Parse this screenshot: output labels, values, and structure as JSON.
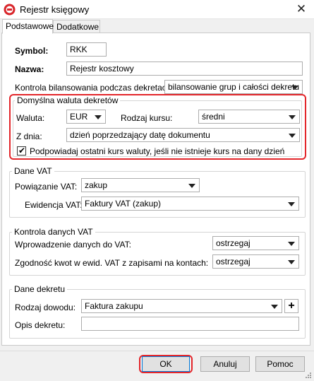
{
  "window": {
    "title": "Rejestr księgowy"
  },
  "tabs": [
    {
      "label": "Podstawowe"
    },
    {
      "label": "Dodatkowe"
    }
  ],
  "general": {
    "symbol_label": "Symbol:",
    "symbol_value": "RKK",
    "name_label": "Nazwa:",
    "name_value": "Rejestr kosztowy",
    "balance_label": "Kontrola bilansowania podczas dekretacji:",
    "balance_value": "bilansowanie grup i całości dekretu"
  },
  "currency_group": {
    "legend": "Domyślna waluta dekretów",
    "currency_label": "Waluta:",
    "currency_value": "EUR",
    "rate_type_label": "Rodzaj kursu:",
    "rate_type_value": "średni",
    "from_day_label": "Z dnia:",
    "from_day_value": "dzień poprzedzający datę dokumentu",
    "suggest_checkbox_label": "Podpowiadaj ostatni kurs waluty, jeśli nie istnieje kurs na dany dzień",
    "suggest_checked": true
  },
  "vat_group": {
    "legend": "Dane VAT",
    "link_label": "Powiązanie VAT:",
    "link_value": "zakup",
    "register_label": "Ewidencja VAT:",
    "register_value": "Faktury VAT (zakup)"
  },
  "vat_control_group": {
    "legend": "Kontrola danych VAT",
    "input_label": "Wprowadzenie danych do VAT:",
    "input_value": "ostrzegaj",
    "consistency_label": "Zgodność kwot w ewid. VAT z zapisami na kontach:",
    "consistency_value": "ostrzegaj"
  },
  "decree_group": {
    "legend": "Dane dekretu",
    "doc_type_label": "Rodzaj dowodu:",
    "doc_type_value": "Faktura zakupu",
    "add_symbol": "+",
    "description_label": "Opis dekretu:",
    "description_value": ""
  },
  "footer": {
    "ok_label": "OK",
    "cancel_label": "Anuluj",
    "help_label": "Pomoc"
  },
  "colors": {
    "highlight": "#e3262b",
    "accent": "#0078d7"
  },
  "icons": {
    "app": "app-logo-icon",
    "close": "close-icon",
    "dropdown": "chevron-down-icon",
    "grip": "resize-grip-icon"
  }
}
